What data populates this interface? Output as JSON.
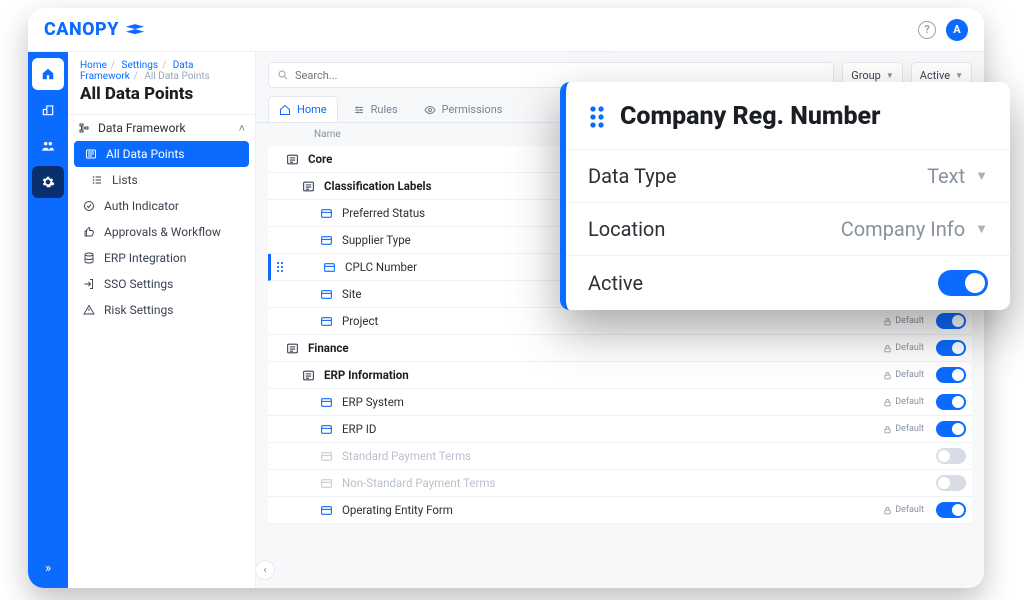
{
  "brand": "CANOPY",
  "avatar_initial": "A",
  "breadcrumbs": {
    "a": "Home",
    "b": "Settings",
    "c": "Data Framework",
    "d": "All Data Points"
  },
  "page_title": "All Data Points",
  "sidebar": {
    "group_head": "Data Framework",
    "items": [
      {
        "label": "All Data Points"
      },
      {
        "label": "Lists"
      }
    ],
    "root_items": [
      {
        "label": "Auth Indicator"
      },
      {
        "label": "Approvals & Workflow"
      },
      {
        "label": "ERP Integration"
      },
      {
        "label": "SSO Settings"
      },
      {
        "label": "Risk Settings"
      }
    ]
  },
  "toolbar": {
    "search_placeholder": "Search...",
    "group_label": "Group",
    "active_label": "Active"
  },
  "tabs": [
    {
      "label": "Home"
    },
    {
      "label": "Rules"
    },
    {
      "label": "Permissions"
    }
  ],
  "table": {
    "col_name": "Name",
    "default_badge": "Default",
    "rows": [
      {
        "kind": "section",
        "indent": 0,
        "label": "Core",
        "badge": false,
        "toggle": null
      },
      {
        "kind": "section",
        "indent": 1,
        "label": "Classification Labels",
        "badge": false,
        "toggle": null
      },
      {
        "kind": "item",
        "indent": 2,
        "label": "Preferred Status",
        "badge": false,
        "toggle": null
      },
      {
        "kind": "item",
        "indent": 2,
        "label": "Supplier Type",
        "badge": false,
        "toggle": null
      },
      {
        "kind": "item",
        "indent": 2,
        "label": "CPLC Number",
        "badge": false,
        "toggle": null,
        "dragging": true
      },
      {
        "kind": "item",
        "indent": 2,
        "label": "Site",
        "badge": true,
        "toggle": "on"
      },
      {
        "kind": "item",
        "indent": 2,
        "label": "Project",
        "badge": true,
        "toggle": "on"
      },
      {
        "kind": "section",
        "indent": 0,
        "label": "Finance",
        "badge": true,
        "toggle": "on"
      },
      {
        "kind": "section",
        "indent": 1,
        "label": "ERP Information",
        "badge": true,
        "toggle": "on"
      },
      {
        "kind": "item",
        "indent": 2,
        "label": "ERP System",
        "badge": true,
        "toggle": "on"
      },
      {
        "kind": "item",
        "indent": 2,
        "label": "ERP ID",
        "badge": true,
        "toggle": "on"
      },
      {
        "kind": "item",
        "indent": 2,
        "label": "Standard Payment Terms",
        "badge": false,
        "toggle": "off",
        "muted": true
      },
      {
        "kind": "item",
        "indent": 2,
        "label": "Non-Standard Payment Terms",
        "badge": false,
        "toggle": "off",
        "muted": true
      },
      {
        "kind": "item",
        "indent": 2,
        "label": "Operating Entity Form",
        "badge": true,
        "toggle": "on"
      }
    ]
  },
  "card": {
    "title": "Company Reg. Number",
    "rows": {
      "datatype_k": "Data Type",
      "datatype_v": "Text",
      "location_k": "Location",
      "location_v": "Company Info",
      "active_k": "Active"
    }
  }
}
